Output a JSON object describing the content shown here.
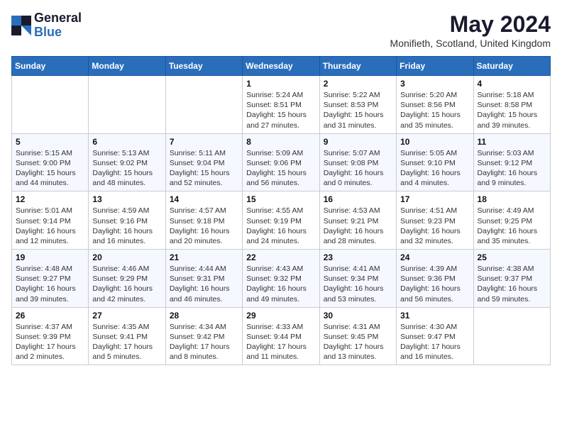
{
  "header": {
    "logo_general": "General",
    "logo_blue": "Blue",
    "month_year": "May 2024",
    "location": "Monifieth, Scotland, United Kingdom"
  },
  "days_of_week": [
    "Sunday",
    "Monday",
    "Tuesday",
    "Wednesday",
    "Thursday",
    "Friday",
    "Saturday"
  ],
  "weeks": [
    [
      {
        "day": "",
        "info": ""
      },
      {
        "day": "",
        "info": ""
      },
      {
        "day": "",
        "info": ""
      },
      {
        "day": "1",
        "info": "Sunrise: 5:24 AM\nSunset: 8:51 PM\nDaylight: 15 hours and 27 minutes."
      },
      {
        "day": "2",
        "info": "Sunrise: 5:22 AM\nSunset: 8:53 PM\nDaylight: 15 hours and 31 minutes."
      },
      {
        "day": "3",
        "info": "Sunrise: 5:20 AM\nSunset: 8:56 PM\nDaylight: 15 hours and 35 minutes."
      },
      {
        "day": "4",
        "info": "Sunrise: 5:18 AM\nSunset: 8:58 PM\nDaylight: 15 hours and 39 minutes."
      }
    ],
    [
      {
        "day": "5",
        "info": "Sunrise: 5:15 AM\nSunset: 9:00 PM\nDaylight: 15 hours and 44 minutes."
      },
      {
        "day": "6",
        "info": "Sunrise: 5:13 AM\nSunset: 9:02 PM\nDaylight: 15 hours and 48 minutes."
      },
      {
        "day": "7",
        "info": "Sunrise: 5:11 AM\nSunset: 9:04 PM\nDaylight: 15 hours and 52 minutes."
      },
      {
        "day": "8",
        "info": "Sunrise: 5:09 AM\nSunset: 9:06 PM\nDaylight: 15 hours and 56 minutes."
      },
      {
        "day": "9",
        "info": "Sunrise: 5:07 AM\nSunset: 9:08 PM\nDaylight: 16 hours and 0 minutes."
      },
      {
        "day": "10",
        "info": "Sunrise: 5:05 AM\nSunset: 9:10 PM\nDaylight: 16 hours and 4 minutes."
      },
      {
        "day": "11",
        "info": "Sunrise: 5:03 AM\nSunset: 9:12 PM\nDaylight: 16 hours and 9 minutes."
      }
    ],
    [
      {
        "day": "12",
        "info": "Sunrise: 5:01 AM\nSunset: 9:14 PM\nDaylight: 16 hours and 12 minutes."
      },
      {
        "day": "13",
        "info": "Sunrise: 4:59 AM\nSunset: 9:16 PM\nDaylight: 16 hours and 16 minutes."
      },
      {
        "day": "14",
        "info": "Sunrise: 4:57 AM\nSunset: 9:18 PM\nDaylight: 16 hours and 20 minutes."
      },
      {
        "day": "15",
        "info": "Sunrise: 4:55 AM\nSunset: 9:19 PM\nDaylight: 16 hours and 24 minutes."
      },
      {
        "day": "16",
        "info": "Sunrise: 4:53 AM\nSunset: 9:21 PM\nDaylight: 16 hours and 28 minutes."
      },
      {
        "day": "17",
        "info": "Sunrise: 4:51 AM\nSunset: 9:23 PM\nDaylight: 16 hours and 32 minutes."
      },
      {
        "day": "18",
        "info": "Sunrise: 4:49 AM\nSunset: 9:25 PM\nDaylight: 16 hours and 35 minutes."
      }
    ],
    [
      {
        "day": "19",
        "info": "Sunrise: 4:48 AM\nSunset: 9:27 PM\nDaylight: 16 hours and 39 minutes."
      },
      {
        "day": "20",
        "info": "Sunrise: 4:46 AM\nSunset: 9:29 PM\nDaylight: 16 hours and 42 minutes."
      },
      {
        "day": "21",
        "info": "Sunrise: 4:44 AM\nSunset: 9:31 PM\nDaylight: 16 hours and 46 minutes."
      },
      {
        "day": "22",
        "info": "Sunrise: 4:43 AM\nSunset: 9:32 PM\nDaylight: 16 hours and 49 minutes."
      },
      {
        "day": "23",
        "info": "Sunrise: 4:41 AM\nSunset: 9:34 PM\nDaylight: 16 hours and 53 minutes."
      },
      {
        "day": "24",
        "info": "Sunrise: 4:39 AM\nSunset: 9:36 PM\nDaylight: 16 hours and 56 minutes."
      },
      {
        "day": "25",
        "info": "Sunrise: 4:38 AM\nSunset: 9:37 PM\nDaylight: 16 hours and 59 minutes."
      }
    ],
    [
      {
        "day": "26",
        "info": "Sunrise: 4:37 AM\nSunset: 9:39 PM\nDaylight: 17 hours and 2 minutes."
      },
      {
        "day": "27",
        "info": "Sunrise: 4:35 AM\nSunset: 9:41 PM\nDaylight: 17 hours and 5 minutes."
      },
      {
        "day": "28",
        "info": "Sunrise: 4:34 AM\nSunset: 9:42 PM\nDaylight: 17 hours and 8 minutes."
      },
      {
        "day": "29",
        "info": "Sunrise: 4:33 AM\nSunset: 9:44 PM\nDaylight: 17 hours and 11 minutes."
      },
      {
        "day": "30",
        "info": "Sunrise: 4:31 AM\nSunset: 9:45 PM\nDaylight: 17 hours and 13 minutes."
      },
      {
        "day": "31",
        "info": "Sunrise: 4:30 AM\nSunset: 9:47 PM\nDaylight: 17 hours and 16 minutes."
      },
      {
        "day": "",
        "info": ""
      }
    ]
  ]
}
